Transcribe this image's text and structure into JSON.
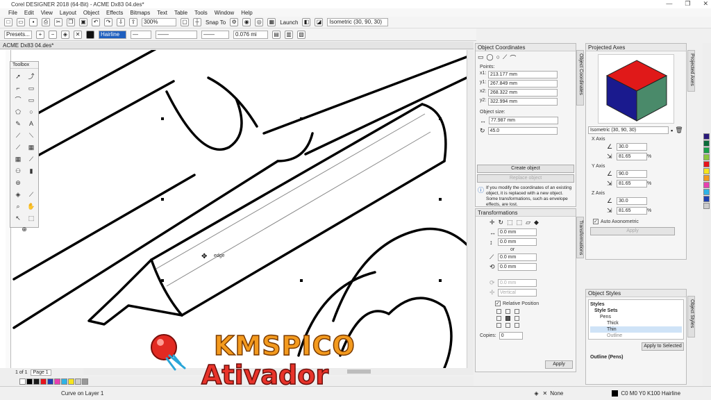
{
  "window": {
    "title": "Corel DESIGNER 2018 (64-Bit) - ACME Dx83 04.des*",
    "controls": [
      "—",
      "❐",
      "✕"
    ]
  },
  "menu": [
    "File",
    "Edit",
    "View",
    "Layout",
    "Object",
    "Effects",
    "Bitmaps",
    "Text",
    "Table",
    "Tools",
    "Window",
    "Help"
  ],
  "toolbar": {
    "zoom": "300%",
    "snap": "Snap To",
    "launch": "Launch",
    "projection": "Isometric (30, 90, 30)"
  },
  "propbar": {
    "presets": "Presets...",
    "outline_width": "Hairline",
    "nudge": "0.076 mi"
  },
  "doc_tab": "ACME Dx83 04.des*",
  "toolbox": {
    "title": "Toolbox"
  },
  "canvas": {
    "edge_label": "edge"
  },
  "page_nav": {
    "counter": "1 of 1",
    "page": "Page 1"
  },
  "palette": [
    "#ffffff",
    "#000000",
    "#1a1a1a",
    "#e8141c",
    "#1e3fb0",
    "#e83fb0",
    "#2eb3e6",
    "#f6e51d",
    "#cccccc",
    "#999999"
  ],
  "status": {
    "left": "Curve on Layer 1",
    "fill": "None",
    "outline": "C0 M0 Y0 K100  Hairline"
  },
  "object_coordinates": {
    "title": "Object Coordinates",
    "points_label": "Points:",
    "x1_label": "x1:",
    "x1": "213.177 mm",
    "y1_label": "y1:",
    "y1": "267.849 mm",
    "x2_label": "x2:",
    "x2": "268.322 mm",
    "y2_label": "y2:",
    "y2": "322.994 mm",
    "size_label": "Object size:",
    "length": "77.987 mm",
    "angle": "45.0",
    "create_btn": "Create object",
    "replace_btn": "Replace object",
    "info": "If you modify the coordinates of an existing object, it is replaced with a new object. Some transformations, such as envelope effects, are lost.",
    "vtab": "Object Coordinates"
  },
  "transformations": {
    "title": "Transformations",
    "w1": "0.0 mm",
    "h1": "0.0 mm",
    "or": "or",
    "x": "0.0 mm",
    "y": "0.0 mm",
    "angle": "0.0 mm",
    "anchor": "Vertical",
    "relative": "Relative Position",
    "copies_label": "Copies:",
    "copies": "0",
    "apply": "Apply",
    "vtab": "Transformations"
  },
  "projected_axes": {
    "title": "Projected Axes",
    "preset": "Isometric (30, 90, 30)",
    "x_label": "X Axis",
    "x_angle": "30.0",
    "x_scale": "81.65",
    "y_label": "Y Axis",
    "y_angle": "90.0",
    "y_scale": "81.65",
    "z_label": "Z Axis",
    "z_angle": "30.0",
    "z_scale": "81.65",
    "pct": "%",
    "auto": "Auto Axonometric",
    "apply": "Apply",
    "vtab": "Projected Axes"
  },
  "object_styles": {
    "title": "Object Styles",
    "items": [
      "Styles",
      "Style Sets",
      "Pens",
      "Thick",
      "Thin",
      "Outline"
    ],
    "apply_selected": "Apply to Selected",
    "outline_pens": "Outline (Pens)",
    "vtab": "Object Styles"
  },
  "watermark": {
    "line1": "KMSPICO",
    "line2": "Ativador"
  }
}
